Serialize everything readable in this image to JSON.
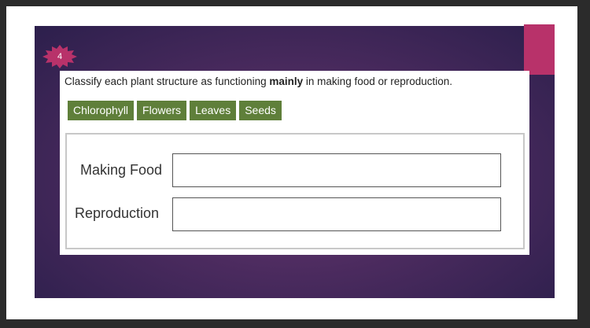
{
  "question": {
    "number": "4",
    "prompt_before": "Classify each plant structure as functioning ",
    "prompt_emphasis": "mainly",
    "prompt_after": " in making food or reproduction."
  },
  "choices": [
    "Chlorophyll",
    "Flowers",
    "Leaves",
    "Seeds"
  ],
  "categories": [
    {
      "label": "Making Food",
      "value": ""
    },
    {
      "label": "Reproduction",
      "value": ""
    }
  ],
  "colors": {
    "accent_tab": "#b8326a",
    "badge": "#b8326a",
    "chip": "#5f7f3a",
    "slide_background": "#4c2b5f"
  },
  "icons": {
    "badge": "starburst-badge-icon"
  }
}
